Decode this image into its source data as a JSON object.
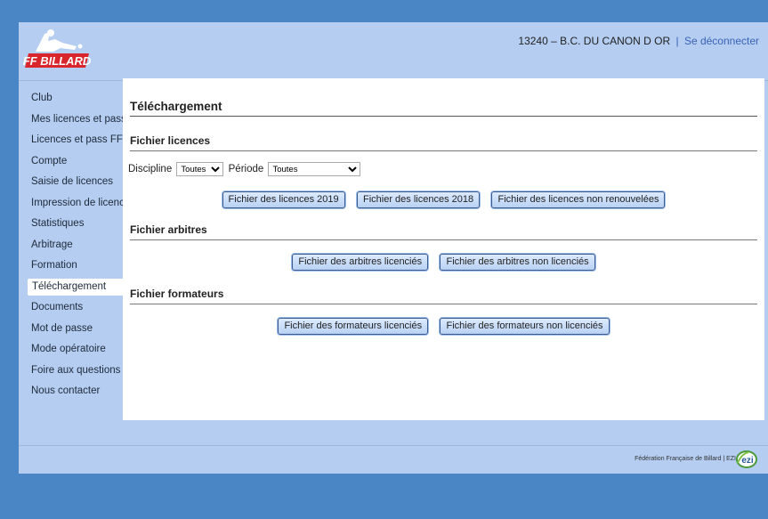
{
  "header": {
    "logo_text": "FF BILLARD",
    "club": "13240 – B.C. DU CANON D OR",
    "separator": "|",
    "logout_label": "Se déconnecter"
  },
  "sidebar": {
    "items": [
      {
        "label": "Club"
      },
      {
        "label": "Mes licences et pass"
      },
      {
        "label": "Licences et pass FFB"
      },
      {
        "label": "Compte"
      },
      {
        "label": "Saisie de licences"
      },
      {
        "label": "Impression de licences"
      },
      {
        "label": "Statistiques"
      },
      {
        "label": "Arbitrage"
      },
      {
        "label": "Formation"
      },
      {
        "label": "Téléchargement",
        "active": true
      },
      {
        "label": "Documents"
      },
      {
        "label": "Mot de passe"
      },
      {
        "label": "Mode opératoire"
      },
      {
        "label": "Foire aux questions"
      },
      {
        "label": "Nous contacter"
      }
    ]
  },
  "main": {
    "title": "Téléchargement",
    "licences": {
      "title": "Fichier licences",
      "discipline_label": "Discipline",
      "discipline_value": "Toutes",
      "periode_label": "Période",
      "periode_value": "Toutes",
      "buttons": [
        "Fichier des licences 2019",
        "Fichier des licences 2018",
        "Fichier des licences non renouvelées"
      ]
    },
    "arbitres": {
      "title": "Fichier arbitres",
      "buttons": [
        "Fichier des arbitres licenciés",
        "Fichier des arbitres non licenciés"
      ]
    },
    "formateurs": {
      "title": "Fichier formateurs",
      "buttons": [
        "Fichier des formateurs licenciés",
        "Fichier des formateurs non licenciés"
      ]
    }
  },
  "footer": {
    "text": "Fédération Française de Billard | EZI",
    "ezi_logo_text": "ezi"
  },
  "colors": {
    "page_bg": "#4a86c5",
    "frame_bg": "#b4cdf0",
    "link": "#3a63b8",
    "logo_red": "#d9262c"
  }
}
